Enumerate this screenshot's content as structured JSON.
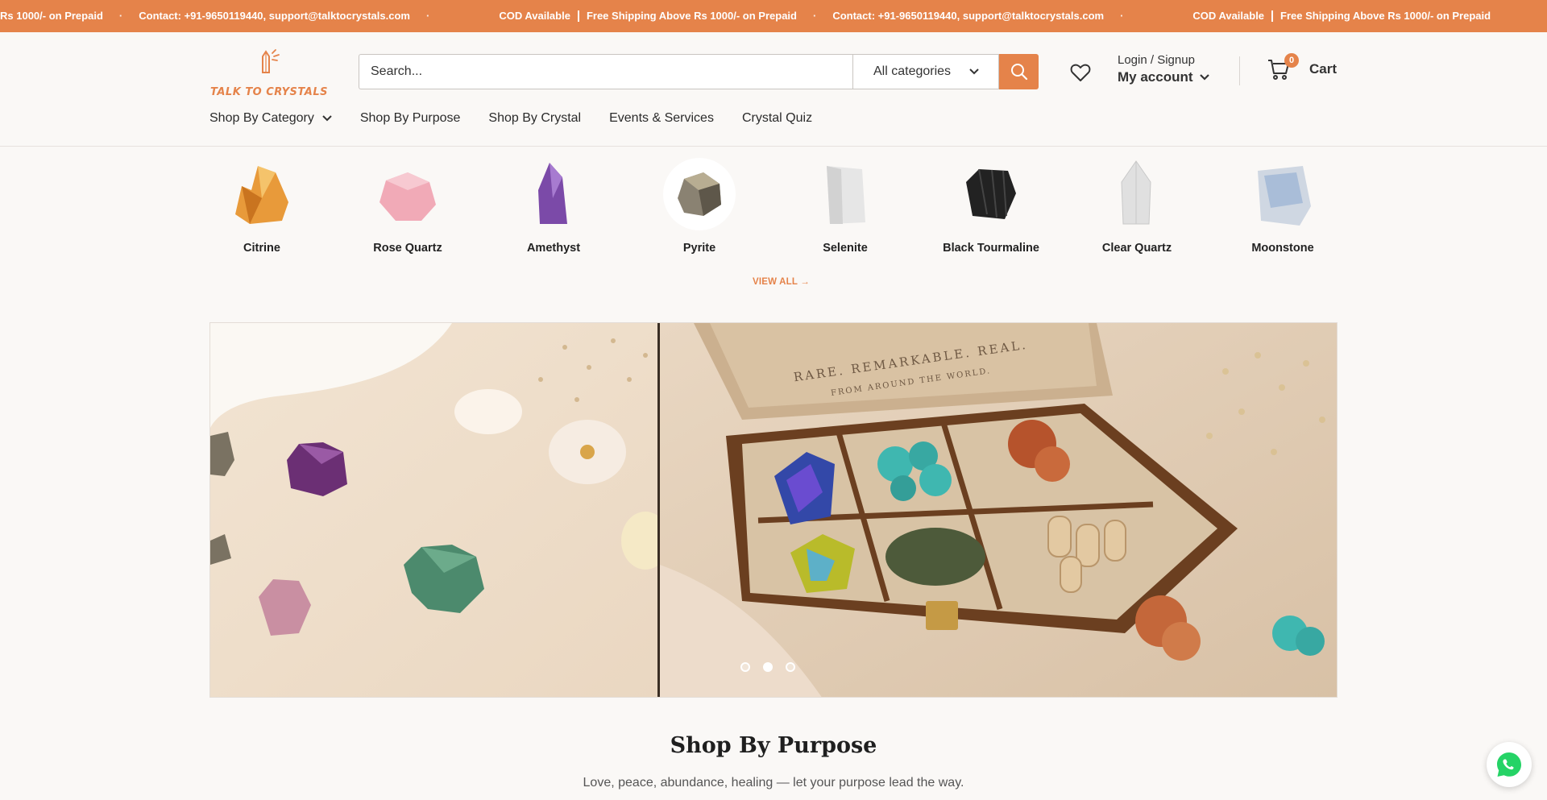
{
  "announcement": {
    "fragment_lead": "Rs 1000/- on Prepaid",
    "contact": "Contact: +91-9650119440, support@talktocrystals.com",
    "cod": "COD Available",
    "shipping": "Free Shipping Above Rs 1000/- on Prepaid",
    "dot": "·",
    "bg_color": "#e5834a"
  },
  "logo": {
    "text": "TALK TO CRYSTALS",
    "icon": "crystal-logo-icon"
  },
  "search": {
    "placeholder": "Search...",
    "category": "All categories",
    "icon": "search-icon"
  },
  "account": {
    "line1": "Login / Signup",
    "line2": "My account"
  },
  "cart": {
    "count": "0",
    "label": "Cart"
  },
  "nav": {
    "items": [
      {
        "label": "Shop By Category"
      },
      {
        "label": "Shop By Purpose"
      },
      {
        "label": "Shop By Crystal"
      },
      {
        "label": "Events & Services"
      },
      {
        "label": "Crystal Quiz"
      }
    ]
  },
  "crystals": {
    "items": [
      {
        "name": "Citrine",
        "color": "#e89a3a"
      },
      {
        "name": "Rose Quartz",
        "color": "#f1aab7"
      },
      {
        "name": "Amethyst",
        "color": "#7b4aa8"
      },
      {
        "name": "Pyrite",
        "color": "#8a8272"
      },
      {
        "name": "Selenite",
        "color": "#e6e6e6"
      },
      {
        "name": "Black Tourmaline",
        "color": "#222222"
      },
      {
        "name": "Clear Quartz",
        "color": "#dadada"
      },
      {
        "name": "Moonstone",
        "color": "#9fb6d6"
      }
    ],
    "view_all": "VIEW ALL →"
  },
  "hero": {
    "box_text_line1": "RARE. REMARKABLE. REAL.",
    "box_text_line2": "FROM AROUND THE WORLD.",
    "slides": 3,
    "active_slide": 2
  },
  "purpose": {
    "title": "Shop By Purpose",
    "subtitle": "Love, peace, abundance, healing — let your purpose lead the way."
  },
  "colors": {
    "accent": "#e5834a",
    "whatsapp": "#25d366"
  }
}
